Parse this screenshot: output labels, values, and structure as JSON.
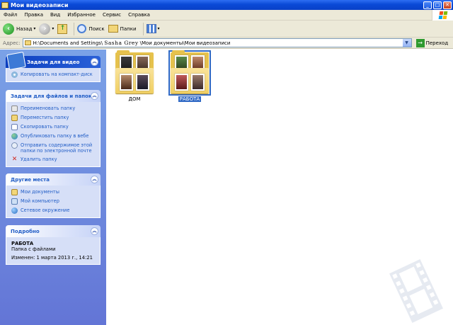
{
  "window": {
    "title": "Мои видеозаписи",
    "colors": {
      "titlebar": "#0a49d6",
      "panel": "#6375d6",
      "selection": "#316ac5"
    }
  },
  "menu": [
    "Файл",
    "Правка",
    "Вид",
    "Избранное",
    "Сервис",
    "Справка"
  ],
  "toolbar": {
    "back_label": "Назад",
    "search_label": "Поиск",
    "folders_label": "Папки"
  },
  "address": {
    "label": "Адрес:",
    "path_prefix": "H:\\Documents and Settings\\",
    "path_user": "Sasha Grey",
    "path_suffix": " \\Мои документы\\Мои видеозаписи",
    "go_label": "Переход"
  },
  "panels": {
    "video_tasks": {
      "title": "Задачи для видео",
      "items": [
        "Копировать на компакт-диск"
      ]
    },
    "file_tasks": {
      "title": "Задачи для файлов и папок",
      "items": [
        "Переименовать папку",
        "Переместить папку",
        "Скопировать папку",
        "Опубликовать папку в вебе",
        "Отправить содержимое этой папки по электронной почте",
        "Удалить папку"
      ]
    },
    "other_places": {
      "title": "Другие места",
      "items": [
        "Мои документы",
        "Мой компьютер",
        "Сетевое окружение"
      ]
    },
    "details": {
      "title": "Подробно",
      "name": "РАБОТА",
      "type": "Папка с файлами",
      "modified": "Изменен: 1 марта 2013 г., 14:21"
    }
  },
  "folders": [
    {
      "name": "ДОМ",
      "selected": false
    },
    {
      "name": "РАБОТА",
      "selected": true
    }
  ],
  "icons": [
    "windows-folder-icon",
    "minimize-icon",
    "maximize-icon",
    "close-icon",
    "windows-logo-icon",
    "back-arrow-icon",
    "forward-arrow-icon",
    "up-folder-icon",
    "search-icon",
    "folders-icon",
    "views-icon",
    "go-arrow-icon",
    "film-watermark-icon"
  ]
}
